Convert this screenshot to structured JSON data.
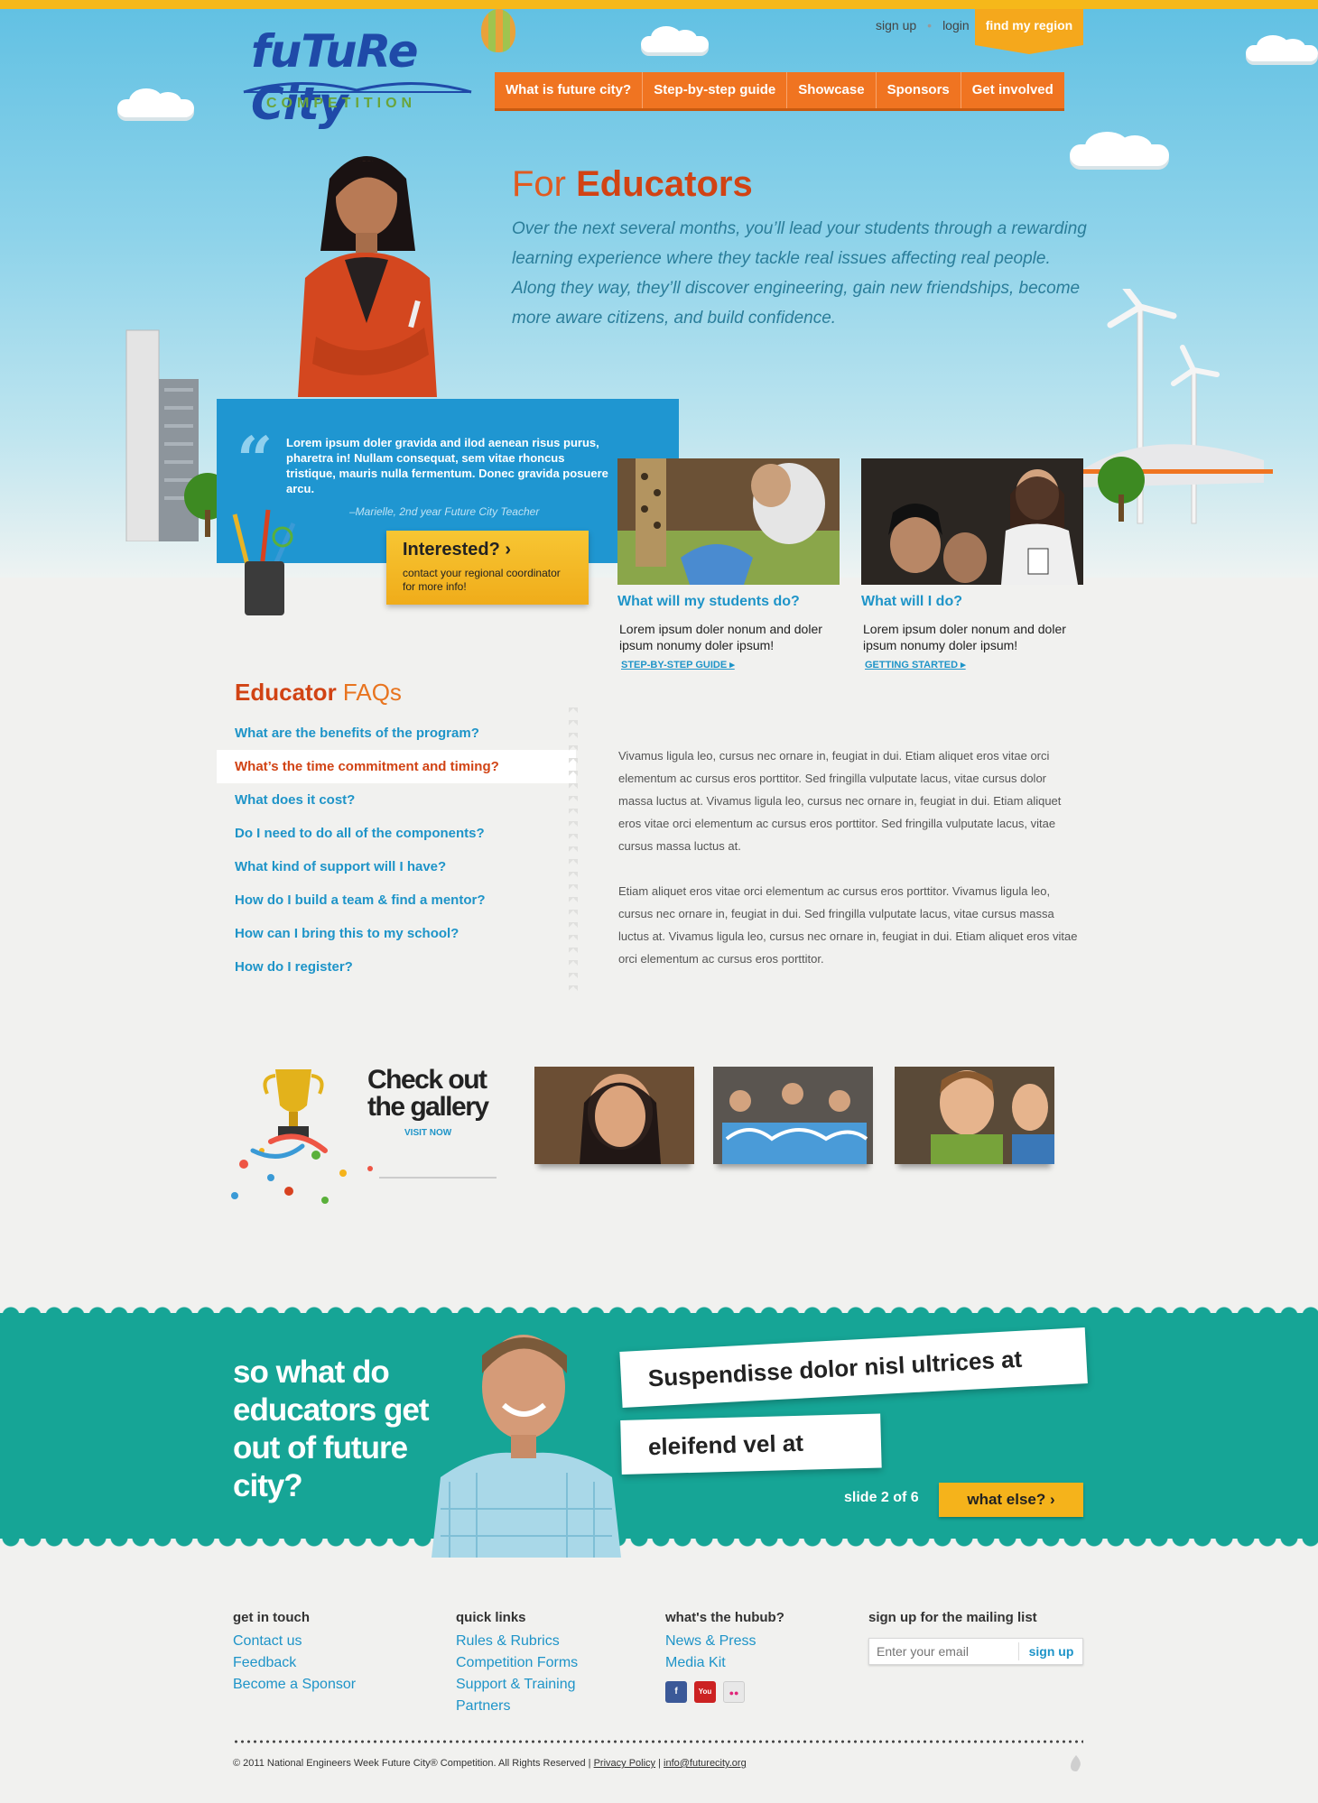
{
  "header": {
    "logo_title": "fuTuRe City",
    "logo_subtitle": "COMPETITION",
    "utility_links": {
      "sign_up": "sign up",
      "login": "login"
    },
    "find_region": "find my region",
    "nav": [
      "What is future city?",
      "Step-by-step guide",
      "Showcase",
      "Sponsors",
      "Get involved"
    ]
  },
  "hero": {
    "title_pre": "For",
    "title_bold": "Educators",
    "intro": "Over the next several months, you’ll lead your students through a rewarding learning experience where they tackle real issues affecting real people. Along they way, they’ll discover engineering, gain new friendships, become more aware citizens, and build confidence."
  },
  "quote": {
    "mark": "“",
    "text": "Lorem ipsum doler gravida and ilod aenean risus purus, pharetra in! Nullam consequat, sem vitae rhoncus tristique, mauris nulla fermentum. Donec gravida posuere arcu.",
    "author": "–Marielle, 2nd year Future City Teacher"
  },
  "interested": {
    "title": "Interested? ›",
    "subtitle": "contact your regional coordinator for more info!"
  },
  "cards": [
    {
      "title": "What will my students do?",
      "text": "Lorem ipsum doler nonum and doler ipsum nonumy doler ipsum!",
      "link": "STEP-BY-STEP GUIDE ▸"
    },
    {
      "title": "What will I do?",
      "text": "Lorem ipsum doler nonum and doler ipsum nonumy doler ipsum!",
      "link": "GETTING STARTED ▸"
    }
  ],
  "faq": {
    "title_bold": "Educator",
    "title_rest": " FAQs",
    "items": [
      "What are the benefits of the program?",
      "What’s the time commitment and timing?",
      "What does it cost?",
      "Do I need to do all of the components?",
      "What kind of support will I have?",
      "How do I build a team & find a mentor?",
      "How can I bring this to my school?",
      "How do I register?"
    ],
    "active_index": 1,
    "answer": [
      "Vivamus ligula leo, cursus nec ornare in, feugiat in dui. Etiam aliquet eros vitae orci elementum ac cursus eros porttitor. Sed fringilla vulputate lacus, vitae cursus dolor massa luctus at. Vivamus ligula leo, cursus nec ornare in, feugiat in dui. Etiam aliquet eros vitae orci elementum ac cursus eros porttitor. Sed fringilla vulputate lacus, vitae cursus massa luctus at.",
      "Etiam aliquet eros vitae orci elementum ac cursus eros porttitor. Vivamus ligula leo, cursus nec ornare in, feugiat in dui. Sed fringilla vulputate lacus, vitae cursus massa luctus at. Vivamus ligula leo, cursus nec ornare in, feugiat in dui. Etiam aliquet eros vitae orci elementum ac cursus eros porttitor."
    ]
  },
  "gallery": {
    "heading_line1": "Check out",
    "heading_line2": "the gallery",
    "visit": "VISIT NOW"
  },
  "feature": {
    "heading": "so what do educators get out of future city?",
    "slide_line1": "Suspendisse dolor nisl ultrices at",
    "slide_line2": "eleifend vel at",
    "slide_count": "slide 2 of 6",
    "cta": "what else? ›"
  },
  "footer": {
    "get_in_touch": {
      "heading": "get in touch",
      "links": [
        "Contact us",
        "Feedback",
        "Become a Sponsor"
      ]
    },
    "quick_links": {
      "heading": "quick links",
      "links": [
        "Rules & Rubrics",
        "Competition Forms",
        "Support & Training",
        "Partners"
      ]
    },
    "hubub": {
      "heading": "what's the hubub?",
      "links": [
        "News & Press",
        "Media Kit"
      ],
      "social": [
        {
          "icon": "facebook-icon",
          "label": "f",
          "color": "#3b5998"
        },
        {
          "icon": "youtube-icon",
          "label": "You",
          "color": "#cc2222"
        },
        {
          "icon": "flickr-icon",
          "label": "●●",
          "color": "#e8e8e8"
        }
      ]
    },
    "mailing": {
      "heading": "sign up for the mailing list",
      "placeholder": "Enter your email",
      "button": "sign up"
    },
    "copyright": "© 2011 National Engineers Week Future City® Competition. All Rights Reserved | ",
    "privacy": "Privacy Policy",
    "separator": " | ",
    "email": "info@futurecity.org"
  },
  "colors": {
    "accent_orange": "#f07421",
    "brand_blue": "#1e94c8",
    "teal": "#16a596",
    "cta_yellow": "#f5b31b",
    "title_red": "#d14314"
  }
}
